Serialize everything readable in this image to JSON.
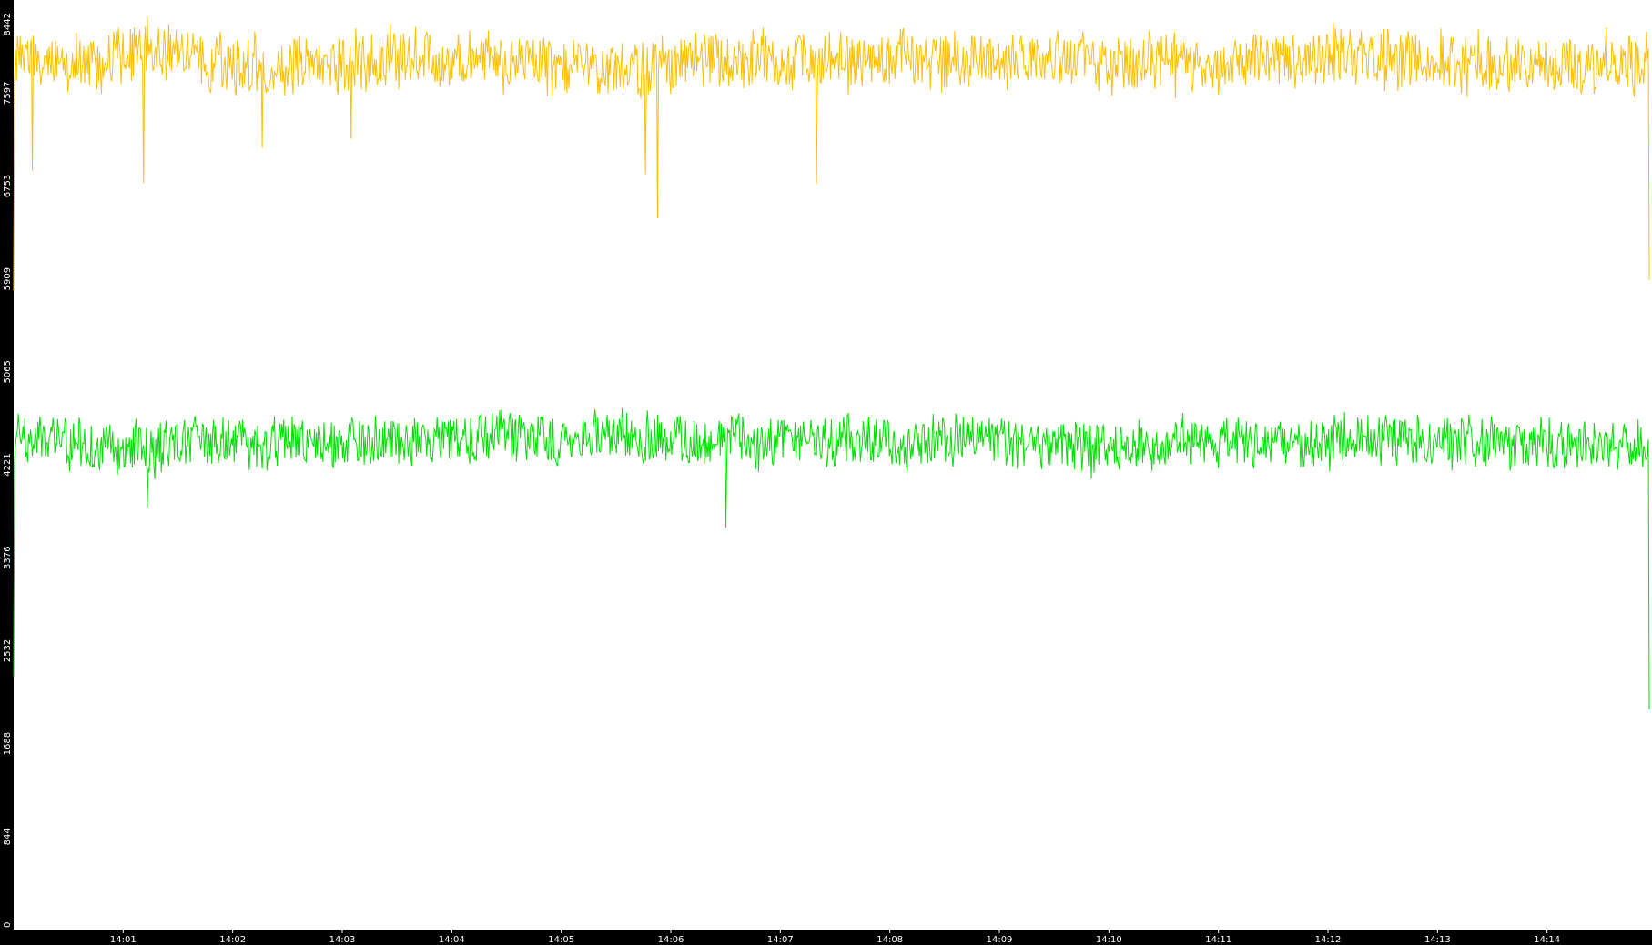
{
  "chart_data": {
    "type": "line",
    "title": "",
    "xlabel": "",
    "ylabel": "",
    "ylim": [
      0,
      8442
    ],
    "y_ticks": [
      "0",
      "844",
      "1688",
      "2532",
      "3376",
      "4221",
      "5065",
      "5909",
      "6753",
      "7597",
      "8442"
    ],
    "x_range": [
      "14:00:00",
      "14:14:56"
    ],
    "x_ticks": [
      "14:01",
      "14:02",
      "14:03",
      "14:04",
      "14:05",
      "14:06",
      "14:07",
      "14:08",
      "14:09",
      "14:10",
      "14:11",
      "14:12",
      "14:13",
      "14:14"
    ],
    "grid": false,
    "legend": "none",
    "series": [
      {
        "color": "#ffc000",
        "description_note": "",
        "baseline": 7900,
        "noise_amplitude": 480,
        "end_value": 5900,
        "start_value": 5800,
        "min": 6460,
        "max": 8442,
        "dips": [
          {
            "time": "14:00:10",
            "value": 6900
          },
          {
            "time": "14:01:11",
            "value": 6780
          },
          {
            "time": "14:02:16",
            "value": 7100
          },
          {
            "time": "14:03:05",
            "value": 7180
          },
          {
            "time": "14:05:46",
            "value": 6860
          },
          {
            "time": "14:05:53",
            "value": 6460
          },
          {
            "time": "14:07:20",
            "value": 6770
          },
          {
            "time": "14:14:48",
            "value": 7560
          }
        ]
      },
      {
        "color": "#00e000",
        "description_note": "",
        "baseline": 4420,
        "noise_amplitude": 420,
        "start_value": 2300,
        "end_value": 2000,
        "min": 3650,
        "max": 5130,
        "dips": [
          {
            "time": "14:01:13",
            "value": 3830
          },
          {
            "time": "14:06:30",
            "value": 3650
          },
          {
            "time": "14:14:56",
            "value": 2000
          }
        ]
      }
    ]
  }
}
